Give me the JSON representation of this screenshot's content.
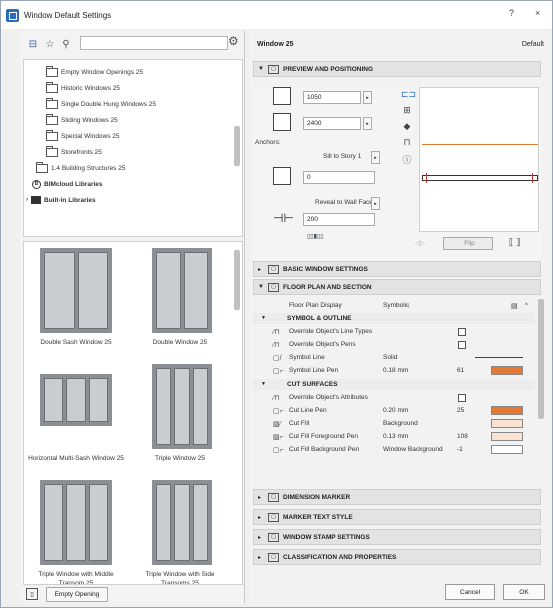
{
  "window": {
    "title": "Window Default Settings",
    "help": "?",
    "close": "×"
  },
  "library": {
    "tree": [
      {
        "label": "Empty Window Openings 25",
        "type": "folder",
        "level": 2
      },
      {
        "label": "Historic Windows 25",
        "type": "folder",
        "level": 2
      },
      {
        "label": "Single Double Hung Windows 25",
        "type": "folder",
        "level": 2
      },
      {
        "label": "Sliding Windows 25",
        "type": "folder",
        "level": 2
      },
      {
        "label": "Special Windows 25",
        "type": "folder",
        "level": 2
      },
      {
        "label": "Storefronts 25",
        "type": "folder",
        "level": 2
      },
      {
        "label": "1.4 Building Structures 25",
        "type": "folder",
        "level": 1
      },
      {
        "label": "BIMcloud Libraries",
        "type": "cloud",
        "level": 0
      },
      {
        "label": "Built-in Libraries",
        "type": "builtin",
        "level": 0
      }
    ],
    "thumbnails": [
      {
        "label": "Double Sash Window 25",
        "panes": 2
      },
      {
        "label": "Double Window 25",
        "panes": 2
      },
      {
        "label": "Horizontal Multi-Sash Window 25",
        "panes": 3
      },
      {
        "label": "Triple Window 25",
        "panes": 3
      },
      {
        "label": "Triple Window with Middle Transom 25",
        "panes": 3
      },
      {
        "label": "Triple Window with Side Transoms 25",
        "panes": 3
      }
    ],
    "empty_opening_label": "Empty Opening"
  },
  "settings": {
    "element_name": "Window 25",
    "default_label": "Default",
    "sections": {
      "preview": "PREVIEW AND POSITIONING",
      "basic": "BASIC WINDOW SETTINGS",
      "floor_plan": "FLOOR PLAN AND SECTION",
      "dimension": "DIMENSION MARKER",
      "marker_text": "MARKER TEXT STYLE",
      "stamp": "WINDOW STAMP SETTINGS",
      "classification": "CLASSIFICATION AND PROPERTIES"
    },
    "preview": {
      "width": "1050",
      "height": "2400",
      "anchor_label": "Anchors:",
      "sill_label": "Sill to Story 1",
      "sill_value": "0",
      "reveal_label": "Reveal to Wall Face",
      "reveal_value": "200",
      "flip_label": "Flip"
    },
    "floor_plan": {
      "display_label": "Floor Plan Display",
      "display_value": "Symbolic",
      "symbol_group": "SYMBOL & OUTLINE",
      "cut_group": "CUT SURFACES",
      "rows": [
        {
          "name": "Override Object's Line Types",
          "kind": "check"
        },
        {
          "name": "Override Object's Pens",
          "kind": "check"
        },
        {
          "name": "Symbol Line",
          "value": "Solid",
          "kind": "line"
        },
        {
          "name": "Symbol Line Pen",
          "value": "0.18 mm",
          "num": "61",
          "kind": "pen-orange"
        },
        {
          "name": "Override Object's Attributes",
          "kind": "check"
        },
        {
          "name": "Cut Line Pen",
          "value": "0.20 mm",
          "num": "25",
          "kind": "pen-orange"
        },
        {
          "name": "Cut Fill",
          "value": "Background",
          "kind": "fill"
        },
        {
          "name": "Cut Fill Foreground Pen",
          "value": "0.13 mm",
          "num": "108",
          "kind": "pen-light"
        },
        {
          "name": "Cut Fill Background Pen",
          "value": "Window Background",
          "num": "-1",
          "kind": "pen-white"
        }
      ]
    },
    "buttons": {
      "cancel": "Cancel",
      "ok": "OK"
    }
  }
}
